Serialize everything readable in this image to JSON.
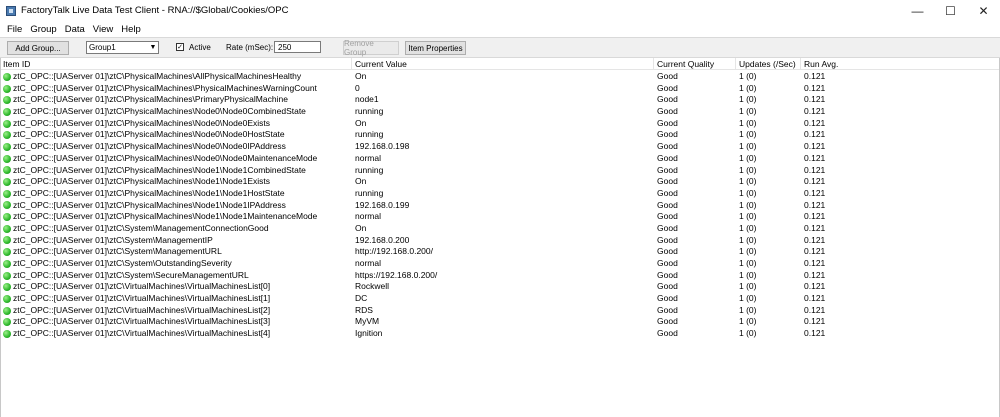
{
  "window": {
    "title": "FactoryTalk Live Data Test Client - RNA://$Global/Cookies/OPC",
    "minimize": "—",
    "maximize": "☐",
    "close": "✕"
  },
  "menu": {
    "items": [
      "File",
      "Group",
      "Data",
      "View",
      "Help"
    ]
  },
  "toolbar": {
    "add_group_label": "Add Group...",
    "group_select_value": "Group1",
    "active_checked": "✓",
    "active_label": "Active",
    "rate_label": "Rate (mSec):",
    "rate_value": "250",
    "remove_group_label": "Remove Group",
    "item_properties_label": "Item Properties"
  },
  "table": {
    "headers": [
      "Item ID",
      "Current Value",
      "Current Quality",
      "Updates (/Sec)",
      "Run Avg."
    ],
    "status_color": "#2cb82a",
    "rows": [
      [
        "ztC_OPC::[UAServer 01]\\ztC\\PhysicalMachines\\AllPhysicalMachinesHealthy",
        "On",
        "Good",
        "1 (0)",
        "0.121"
      ],
      [
        "ztC_OPC::[UAServer 01]\\ztC\\PhysicalMachines\\PhysicalMachinesWarningCount",
        "0",
        "Good",
        "1 (0)",
        "0.121"
      ],
      [
        "ztC_OPC::[UAServer 01]\\ztC\\PhysicalMachines\\PrimaryPhysicalMachine",
        "node1",
        "Good",
        "1 (0)",
        "0.121"
      ],
      [
        "ztC_OPC::[UAServer 01]\\ztC\\PhysicalMachines\\Node0\\Node0CombinedState",
        "running",
        "Good",
        "1 (0)",
        "0.121"
      ],
      [
        "ztC_OPC::[UAServer 01]\\ztC\\PhysicalMachines\\Node0\\Node0Exists",
        "On",
        "Good",
        "1 (0)",
        "0.121"
      ],
      [
        "ztC_OPC::[UAServer 01]\\ztC\\PhysicalMachines\\Node0\\Node0HostState",
        "running",
        "Good",
        "1 (0)",
        "0.121"
      ],
      [
        "ztC_OPC::[UAServer 01]\\ztC\\PhysicalMachines\\Node0\\Node0IPAddress",
        "192.168.0.198",
        "Good",
        "1 (0)",
        "0.121"
      ],
      [
        "ztC_OPC::[UAServer 01]\\ztC\\PhysicalMachines\\Node0\\Node0MaintenanceMode",
        "normal",
        "Good",
        "1 (0)",
        "0.121"
      ],
      [
        "ztC_OPC::[UAServer 01]\\ztC\\PhysicalMachines\\Node1\\Node1CombinedState",
        "running",
        "Good",
        "1 (0)",
        "0.121"
      ],
      [
        "ztC_OPC::[UAServer 01]\\ztC\\PhysicalMachines\\Node1\\Node1Exists",
        "On",
        "Good",
        "1 (0)",
        "0.121"
      ],
      [
        "ztC_OPC::[UAServer 01]\\ztC\\PhysicalMachines\\Node1\\Node1HostState",
        "running",
        "Good",
        "1 (0)",
        "0.121"
      ],
      [
        "ztC_OPC::[UAServer 01]\\ztC\\PhysicalMachines\\Node1\\Node1IPAddress",
        "192.168.0.199",
        "Good",
        "1 (0)",
        "0.121"
      ],
      [
        "ztC_OPC::[UAServer 01]\\ztC\\PhysicalMachines\\Node1\\Node1MaintenanceMode",
        "normal",
        "Good",
        "1 (0)",
        "0.121"
      ],
      [
        "ztC_OPC::[UAServer 01]\\ztC\\System\\ManagementConnectionGood",
        "On",
        "Good",
        "1 (0)",
        "0.121"
      ],
      [
        "ztC_OPC::[UAServer 01]\\ztC\\System\\ManagementIP",
        "192.168.0.200",
        "Good",
        "1 (0)",
        "0.121"
      ],
      [
        "ztC_OPC::[UAServer 01]\\ztC\\System\\ManagementURL",
        "http://192.168.0.200/",
        "Good",
        "1 (0)",
        "0.121"
      ],
      [
        "ztC_OPC::[UAServer 01]\\ztC\\System\\OutstandingSeverity",
        "normal",
        "Good",
        "1 (0)",
        "0.121"
      ],
      [
        "ztC_OPC::[UAServer 01]\\ztC\\System\\SecureManagementURL",
        "https://192.168.0.200/",
        "Good",
        "1 (0)",
        "0.121"
      ],
      [
        "ztC_OPC::[UAServer 01]\\ztC\\VirtualMachines\\VirtualMachinesList[0]",
        "Rockwell",
        "Good",
        "1 (0)",
        "0.121"
      ],
      [
        "ztC_OPC::[UAServer 01]\\ztC\\VirtualMachines\\VirtualMachinesList[1]",
        "DC",
        "Good",
        "1 (0)",
        "0.121"
      ],
      [
        "ztC_OPC::[UAServer 01]\\ztC\\VirtualMachines\\VirtualMachinesList[2]",
        "RDS",
        "Good",
        "1 (0)",
        "0.121"
      ],
      [
        "ztC_OPC::[UAServer 01]\\ztC\\VirtualMachines\\VirtualMachinesList[3]",
        "MyVM",
        "Good",
        "1 (0)",
        "0.121"
      ],
      [
        "ztC_OPC::[UAServer 01]\\ztC\\VirtualMachines\\VirtualMachinesList[4]",
        "Ignition",
        "Good",
        "1 (0)",
        "0.121"
      ]
    ]
  }
}
